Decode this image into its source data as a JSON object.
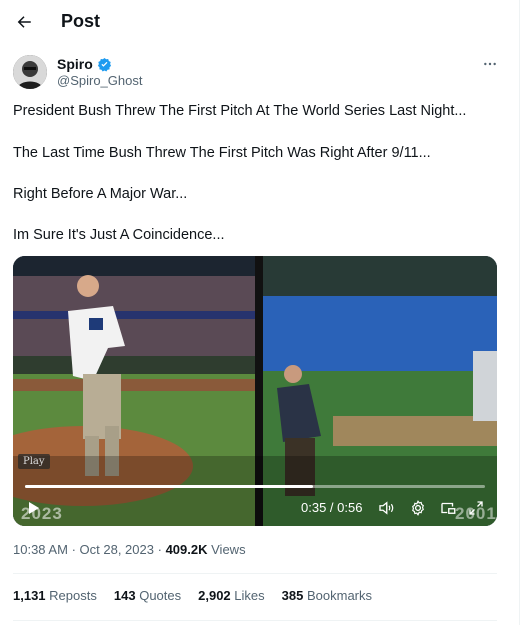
{
  "header": {
    "title": "Post",
    "back_icon": "arrow-left-icon"
  },
  "author": {
    "display_name": "Spiro",
    "handle": "@Spiro_Ghost",
    "verified_color": "#1d9bf0"
  },
  "tweet": {
    "lines": [
      "President Bush Threw The First Pitch At The World Series Last Night...",
      "The Last Time Bush Threw The First Pitch Was Right After 9/11...",
      "Right Before A Major War...",
      "Im Sure It's Just A Coincidence..."
    ]
  },
  "video": {
    "badge": "Play",
    "left_year": "2023",
    "right_year": "2001",
    "time": "0:35 / 0:56",
    "progress": 0.625
  },
  "meta": {
    "time": "10:38 AM",
    "date": "Oct 28, 2023",
    "separator": "·",
    "views": "409.2K",
    "views_label": "Views"
  },
  "stats": [
    {
      "count": "1,131",
      "label": "Reposts"
    },
    {
      "count": "143",
      "label": "Quotes"
    },
    {
      "count": "2,902",
      "label": "Likes"
    },
    {
      "count": "385",
      "label": "Bookmarks"
    }
  ]
}
